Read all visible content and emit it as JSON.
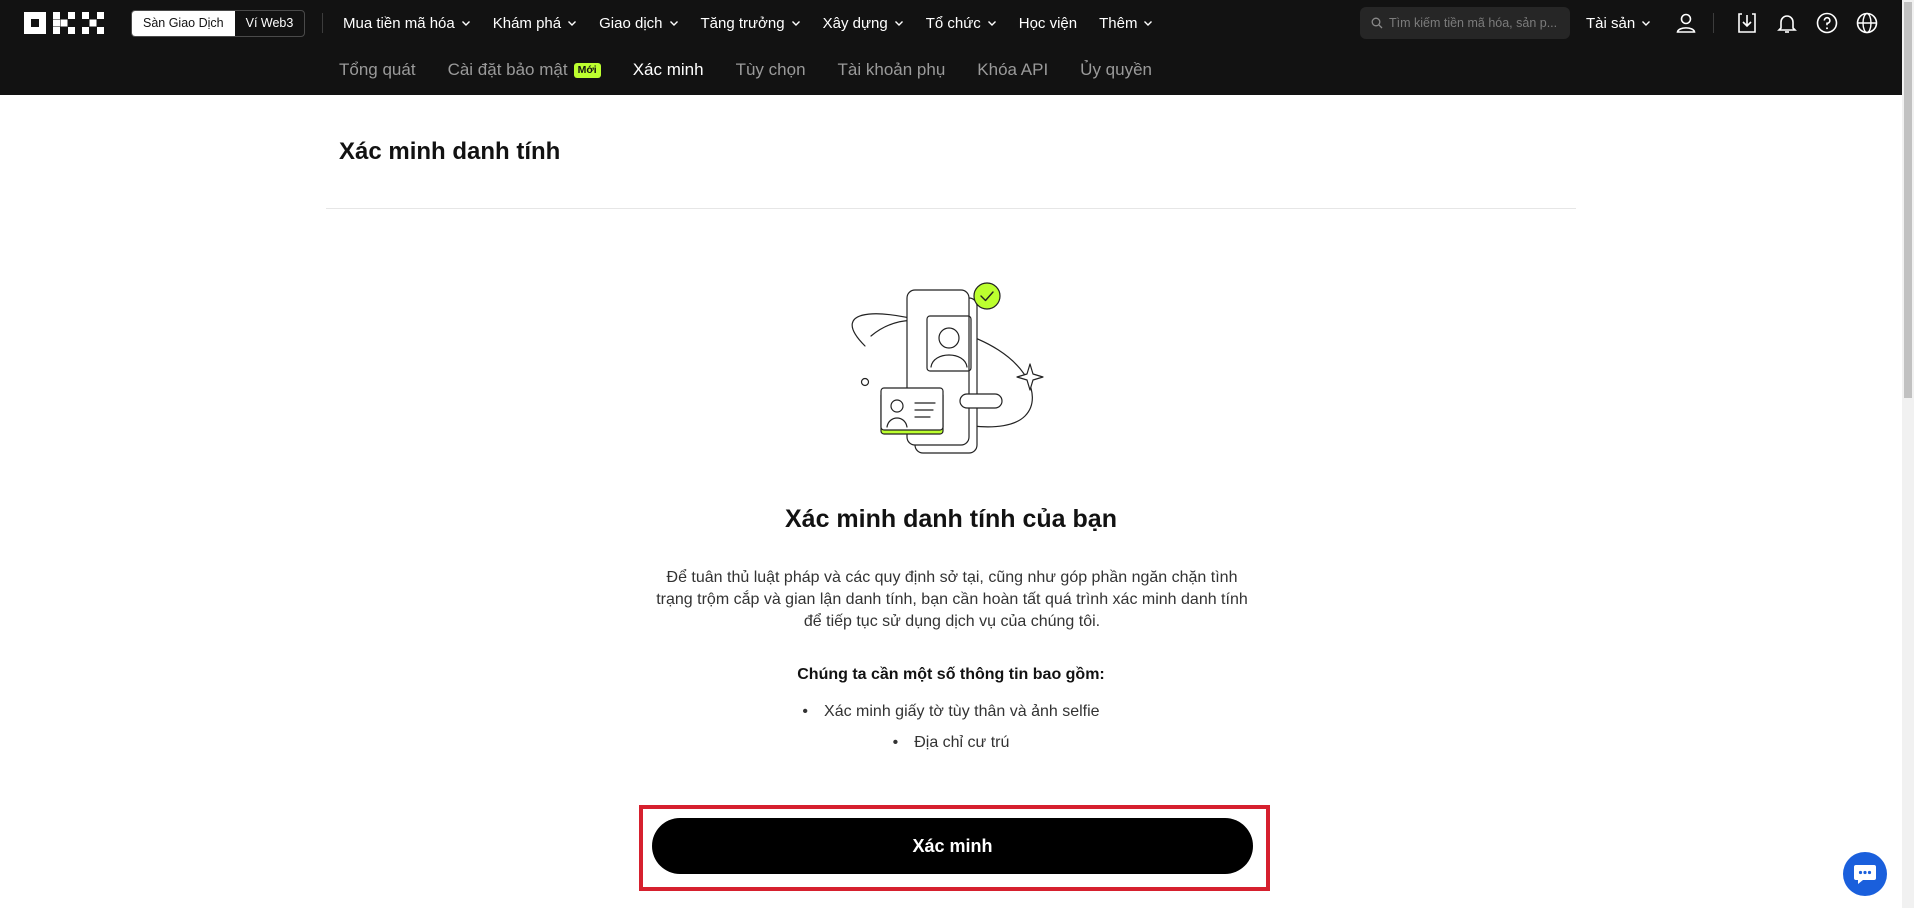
{
  "header": {
    "logo_icon": "okx-logo",
    "mode_switch": {
      "exchange": "Sàn Giao Dịch",
      "web3": "Ví Web3",
      "active": "exchange"
    },
    "nav": [
      {
        "label": "Mua tiền mã hóa",
        "has_dropdown": true
      },
      {
        "label": "Khám phá",
        "has_dropdown": true
      },
      {
        "label": "Giao dịch",
        "has_dropdown": true
      },
      {
        "label": "Tăng trưởng",
        "has_dropdown": true
      },
      {
        "label": "Xây dựng",
        "has_dropdown": true
      },
      {
        "label": "Tổ chức",
        "has_dropdown": true
      },
      {
        "label": "Học viện",
        "has_dropdown": false
      },
      {
        "label": "Thêm",
        "has_dropdown": true
      }
    ],
    "search": {
      "placeholder": "Tìm kiếm tiền mã hóa, sản p...",
      "icon": "search-icon"
    },
    "assets": "Tài sản",
    "icons": [
      "user-icon",
      "download-icon",
      "bell-icon",
      "help-icon",
      "globe-icon"
    ]
  },
  "subnav": {
    "items": [
      {
        "label": "Tổng quát"
      },
      {
        "label": "Cài đặt bảo mật",
        "badge": "Mới"
      },
      {
        "label": "Xác minh",
        "active": true
      },
      {
        "label": "Tùy chọn"
      },
      {
        "label": "Tài khoản phụ"
      },
      {
        "label": "Khóa API"
      },
      {
        "label": "Ủy quyền"
      }
    ]
  },
  "main": {
    "page_title": "Xác minh danh tính",
    "illustration": "identity-verification-illustration",
    "heading": "Xác minh danh tính của bạn",
    "description": "Để tuân thủ luật pháp và các quy định sở tại, cũng như góp phần ngăn chặn tình trạng trộm cắp và gian lận danh tính, bạn cần hoàn tất quá trình xác minh danh tính để tiếp tục sử dụng dịch vụ của chúng tôi.",
    "requirements_title": "Chúng ta cần một số thông tin bao gồm:",
    "requirements": [
      "Xác minh giấy tờ tùy thân và ảnh selfie",
      "Địa chỉ cư trú"
    ],
    "verify_button": "Xác minh"
  },
  "chat": {
    "icon": "chat-icon"
  },
  "colors": {
    "header_bg": "#121212",
    "accent_lime": "#bcff2f",
    "primary_button": "#000000",
    "highlight_frame": "#d6202e",
    "chat_button": "#1a5fdc"
  }
}
